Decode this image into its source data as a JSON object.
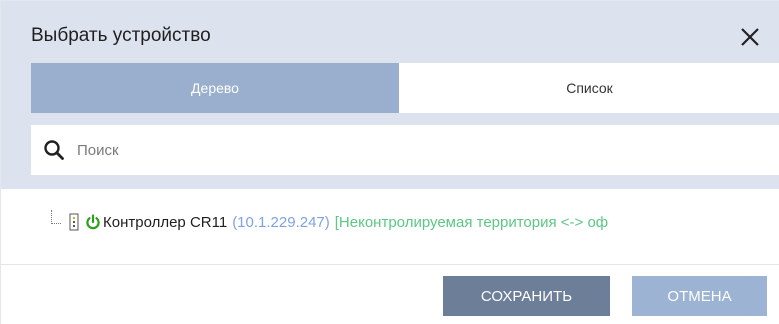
{
  "dialog": {
    "title": "Выбрать устройство",
    "close_icon": "close-icon"
  },
  "tabs": {
    "tree_label": "Дерево",
    "list_label": "Список",
    "active": "tree"
  },
  "search": {
    "placeholder": "Поиск",
    "value": "",
    "icon": "search-icon"
  },
  "tree": {
    "items": [
      {
        "name": "Контроллер CR11",
        "ip": "(10.1.229.247)",
        "zone": "[Неконтролируемая территория <-> оф",
        "status_icon": "power-icon",
        "device_icon": "controller-icon"
      }
    ]
  },
  "footer": {
    "save_label": "СОХРАНИТЬ",
    "cancel_label": "ОТМЕНА"
  },
  "colors": {
    "header_bg": "#dde3ee",
    "tab_active_bg": "#9aafcd",
    "ip_text": "#7ea3e0",
    "zone_text": "#5cc784",
    "power_icon": "#2e9f1e",
    "save_button": "#6d7e98",
    "cancel_button": "#9cb3d4"
  }
}
